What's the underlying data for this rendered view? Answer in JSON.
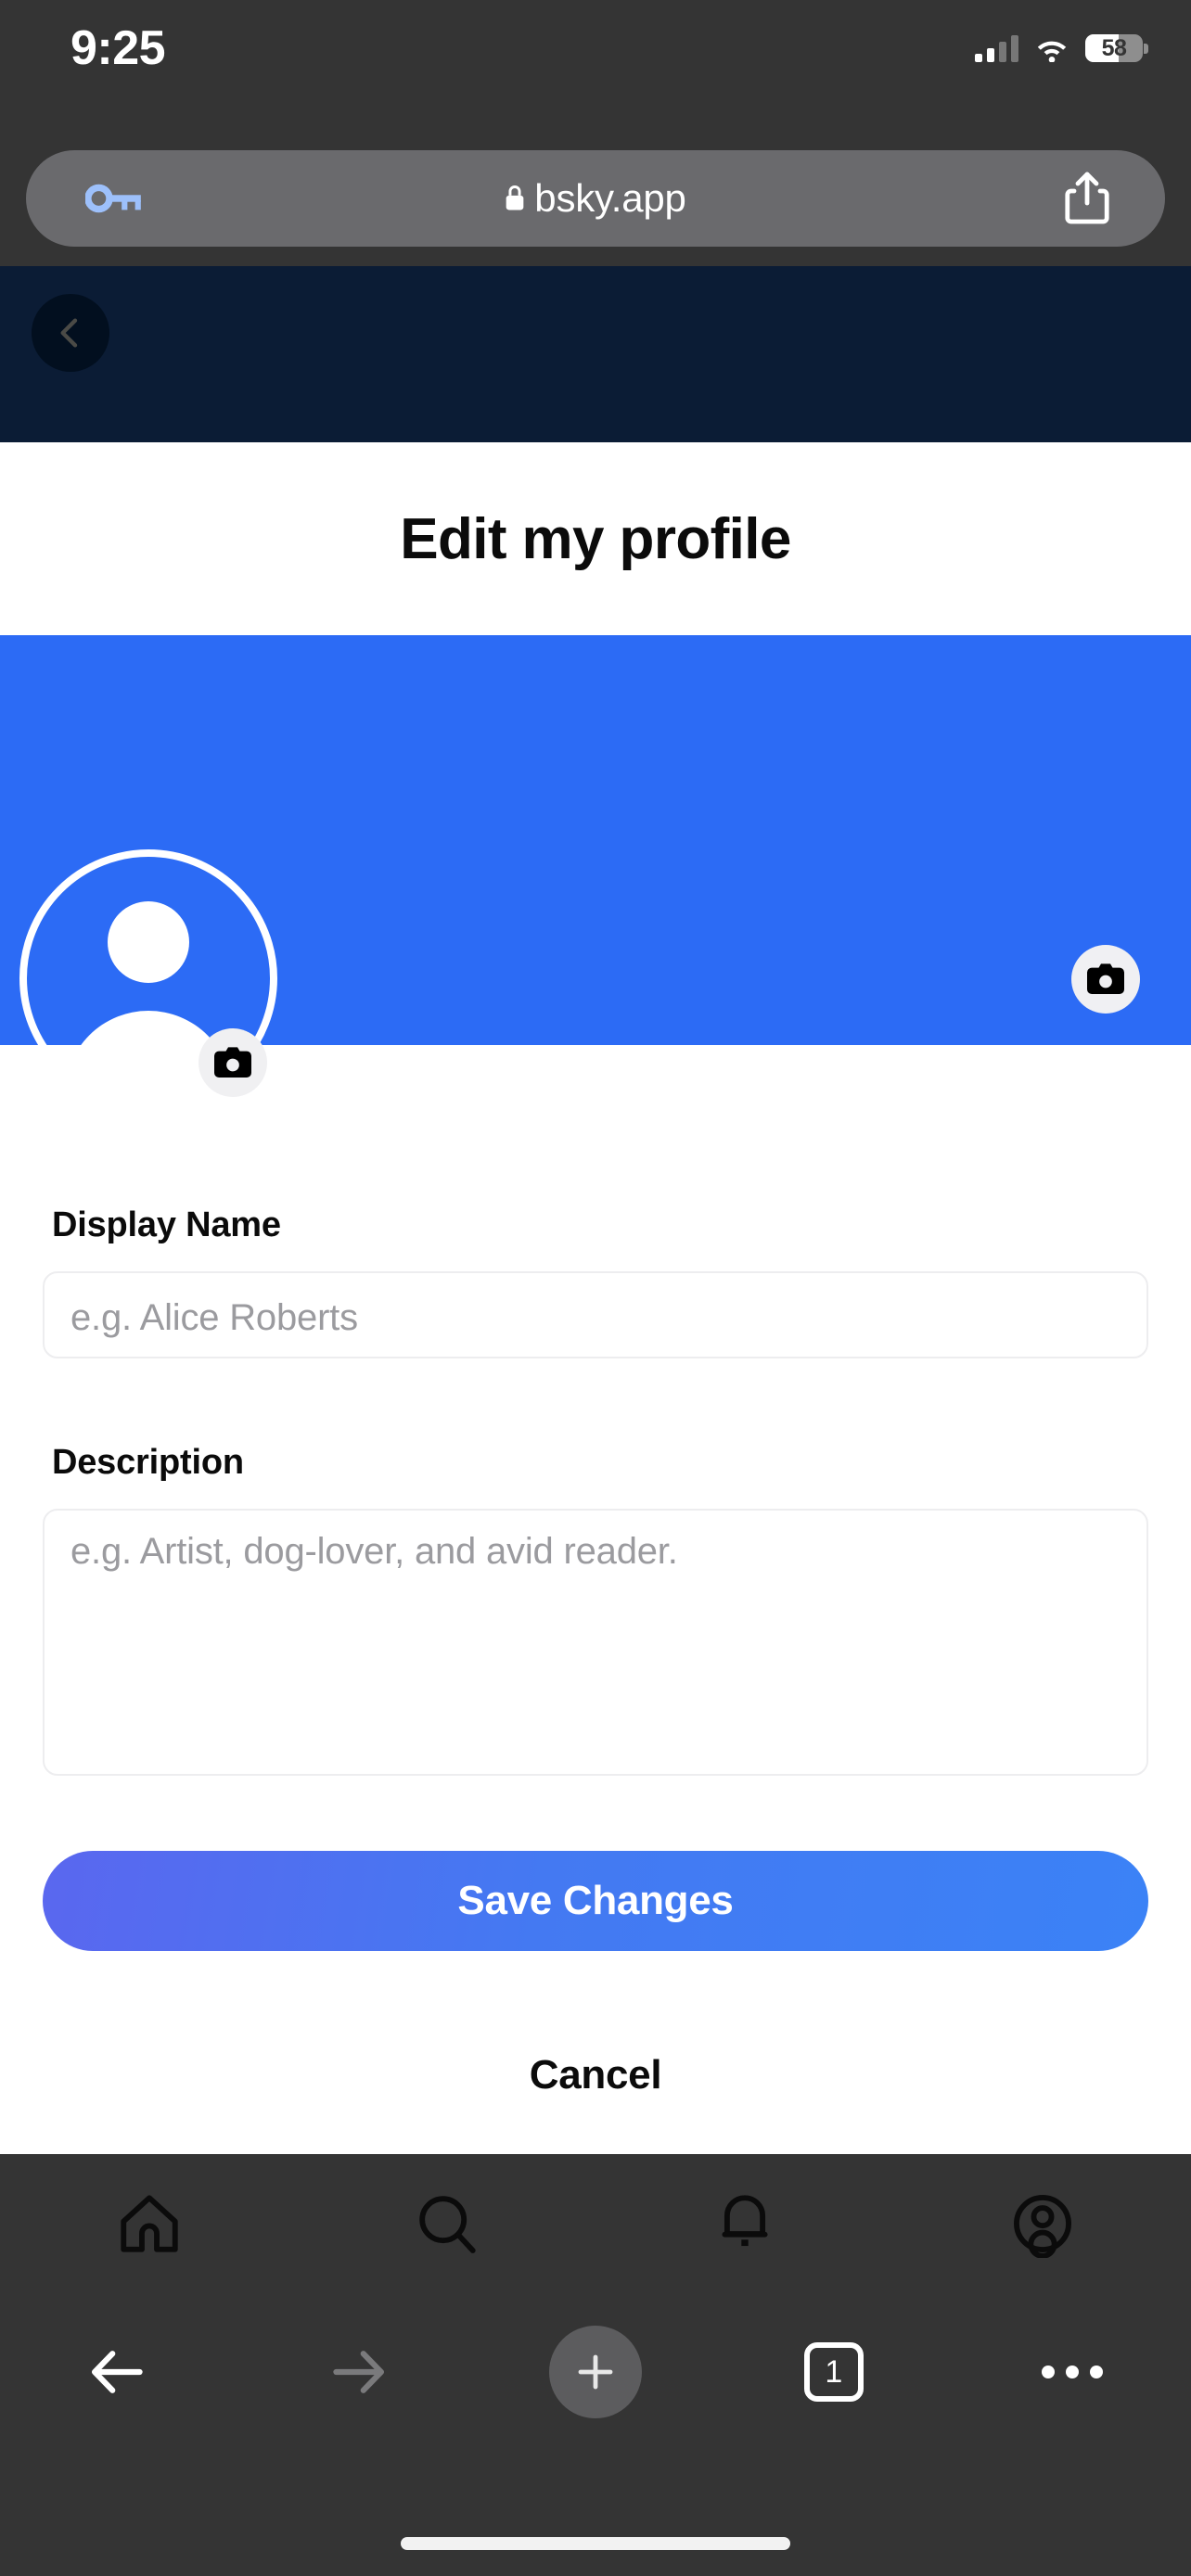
{
  "status_bar": {
    "time": "9:25",
    "battery_percent": "58",
    "signal_icon": "cellular-signal-icon",
    "wifi_icon": "wifi-icon",
    "battery_icon": "battery-icon"
  },
  "browser": {
    "url_text": "bsky.app",
    "lock_icon": "lock-icon",
    "key_icon": "passwords-key-icon",
    "share_icon": "share-icon",
    "toolbar": {
      "back_icon": "arrow-left-icon",
      "forward_icon": "arrow-right-icon",
      "new_tab_icon": "plus-icon",
      "tab_count": "1",
      "more_icon": "ellipsis-icon"
    }
  },
  "app_header": {
    "back_icon": "chevron-left-icon",
    "background_color": "#0b1c35"
  },
  "page": {
    "title": "Edit my profile"
  },
  "banner": {
    "color": "#2c6bf5",
    "edit_banner_icon": "camera-icon"
  },
  "avatar": {
    "placeholder_icon": "person-icon",
    "edit_avatar_icon": "camera-icon"
  },
  "form": {
    "display_name": {
      "label": "Display Name",
      "placeholder": "e.g. Alice Roberts",
      "value": ""
    },
    "description": {
      "label": "Description",
      "placeholder": "e.g. Artist, dog-lover, and avid reader.",
      "value": ""
    },
    "save_label": "Save Changes",
    "cancel_label": "Cancel",
    "save_gradient_start": "#5a67ef",
    "save_gradient_end": "#3b82f6"
  },
  "app_nav": {
    "items": [
      {
        "name": "home",
        "icon": "home-icon"
      },
      {
        "name": "search",
        "icon": "search-icon"
      },
      {
        "name": "notifications",
        "icon": "bell-icon"
      },
      {
        "name": "profile",
        "icon": "person-circle-icon"
      }
    ]
  }
}
